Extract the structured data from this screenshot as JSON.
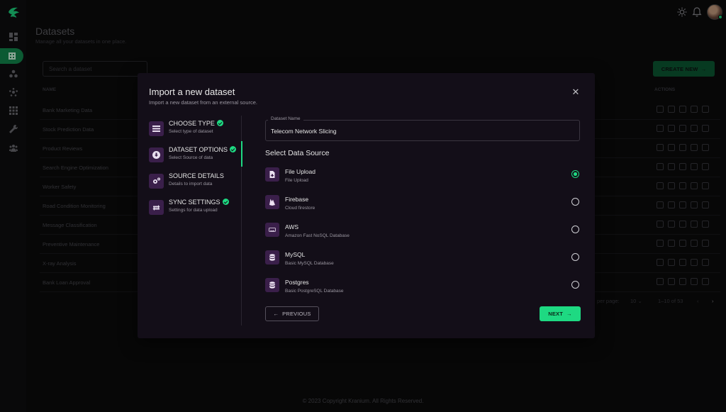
{
  "app": {
    "nav_icons": [
      "dashboard-icon",
      "datasets-icon",
      "models-icon",
      "pipelines-icon",
      "apps-icon",
      "tools-icon",
      "team-icon"
    ]
  },
  "topbar": {
    "icons": [
      "theme-toggle-icon",
      "notifications-icon"
    ]
  },
  "page": {
    "title": "Datasets",
    "subtitle": "Manage all your datasets in one place.",
    "search_placeholder": "Search a dataset",
    "create_label": "CREATE NEW",
    "columns": {
      "name": "NAME",
      "actions": "ACTIONS"
    },
    "rows": [
      "Bank Marketing Data",
      "Stock Prediction Data",
      "Product Reviews",
      "Search Engine Optimization",
      "Worker Safety",
      "Road Condition Monitoring",
      "Message Classification",
      "Preventive Maintenance",
      "X-ray Analysis",
      "Bank Loan Approval"
    ],
    "pagination": {
      "rows_per_page_label": "per page:",
      "rows_per_page": "10",
      "range": "1–10 of 53"
    },
    "footer": "© 2023 Copyright Kranium. All Rights Reserved."
  },
  "modal": {
    "title": "Import a new dataset",
    "subtitle": "Import a new dataset from an external source.",
    "close_icon": "close-icon",
    "steps": [
      {
        "label": "CHOOSE TYPE",
        "desc": "Select type of dataset",
        "done": true,
        "icon": "list-icon"
      },
      {
        "label": "DATASET OPTIONS",
        "desc": "Select Source of data",
        "done": true,
        "icon": "download-icon"
      },
      {
        "label": "SOURCE DETAILS",
        "desc": "Details to import data",
        "done": false,
        "icon": "settings-icon"
      },
      {
        "label": "SYNC SETTINGS",
        "desc": "Settings for data upload",
        "done": true,
        "icon": "sync-icon"
      }
    ],
    "active_step": 1,
    "dataset_name_label": "Dataset Name",
    "dataset_name_value": "Telecom Network Slicing",
    "section_title": "Select Data Source",
    "sources": [
      {
        "title": "File Upload",
        "desc": "File Upload",
        "icon": "file-icon",
        "selected": true
      },
      {
        "title": "Firebase",
        "desc": "Cloud firestore",
        "icon": "firebase-icon",
        "selected": false
      },
      {
        "title": "AWS",
        "desc": "Amazon Fast NoSQL Database",
        "icon": "aws-icon",
        "selected": false
      },
      {
        "title": "MySQL",
        "desc": "Basic MySQL Database",
        "icon": "database-icon",
        "selected": false
      },
      {
        "title": "Postgres",
        "desc": "Basic PostgreSQL Database",
        "icon": "database-icon",
        "selected": false
      }
    ],
    "previous_label": "PREVIOUS",
    "next_label": "NEXT"
  },
  "colors": {
    "accent": "#1ed982",
    "modal_bg": "#130e18",
    "icon_tile": "#3a1f4a"
  }
}
